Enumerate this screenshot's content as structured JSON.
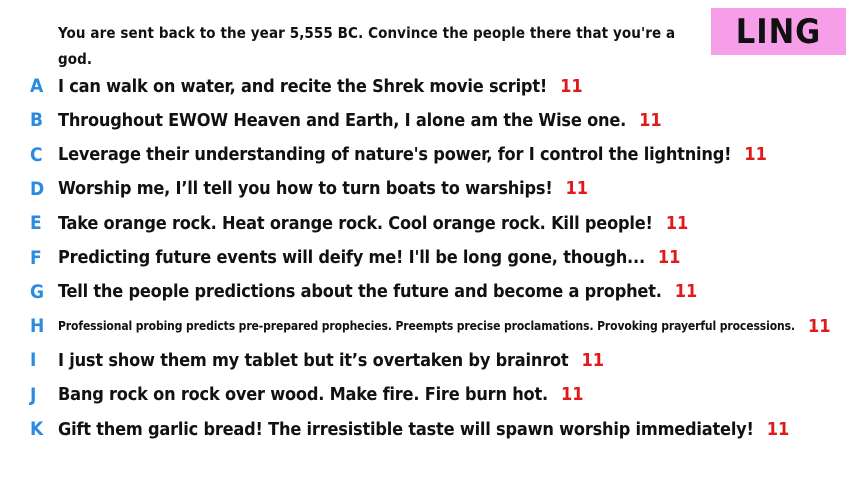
{
  "prompt": "You are sent back to the year 5,555 BC. Convince the people there that you're a god.",
  "badge": "LING",
  "colors": {
    "letter": "#2a8be0",
    "score": "#e01a1a",
    "badge_bg": "#f79ee8",
    "text": "#111111"
  },
  "entries": [
    {
      "letter": "A",
      "text": "I can walk on water, and recite the Shrek movie script!",
      "score": "11"
    },
    {
      "letter": "B",
      "text": "Throughout EWOW Heaven and Earth, I alone am the Wise one.",
      "score": "11"
    },
    {
      "letter": "C",
      "text": "Leverage their understanding of nature's power, for I control the lightning!",
      "score": "11"
    },
    {
      "letter": "D",
      "text": "Worship me, I’ll tell you how to turn boats to warships!",
      "score": "11"
    },
    {
      "letter": "E",
      "text": "Take orange rock. Heat orange rock. Cool orange rock. Kill people!",
      "score": "11"
    },
    {
      "letter": "F",
      "text": "Predicting future events will deify me! I'll be long gone, though...",
      "score": "11"
    },
    {
      "letter": "G",
      "text": "Tell the people predictions about the future and become a prophet.",
      "score": "11"
    },
    {
      "letter": "H",
      "text": "Professional probing predicts pre-prepared prophecies. Preempts precise proclamations. Provoking prayerful processions.",
      "score": "11"
    },
    {
      "letter": "I",
      "text": "I just show them my tablet but it’s overtaken by brainrot",
      "score": "11"
    },
    {
      "letter": "J",
      "text": "Bang rock on rock over wood. Make fire. Fire burn hot.",
      "score": "11"
    },
    {
      "letter": "K",
      "text": "Gift them garlic bread! The irresistible taste will spawn worship immediately!",
      "score": "11"
    }
  ]
}
